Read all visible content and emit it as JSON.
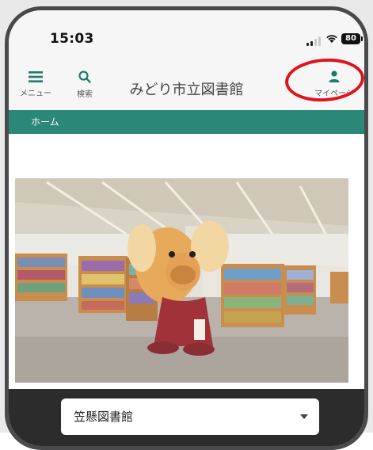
{
  "status_bar": {
    "time": "15:03",
    "battery": "80"
  },
  "header": {
    "menu_label": "メニュー",
    "search_label": "検索",
    "title": "みどり市立図書館",
    "mypage_label": "マイページ"
  },
  "breadcrumb": {
    "home": "ホーム"
  },
  "library_select": {
    "selected": "笠懸図書館"
  },
  "colors": {
    "accent": "#2b8777",
    "highlight": "#e0131a",
    "dark_band": "#2c2c2c"
  },
  "icons": {
    "menu": "menu-icon",
    "search": "search-icon",
    "mypage": "person-icon",
    "caret": "chevron-down-icon"
  }
}
